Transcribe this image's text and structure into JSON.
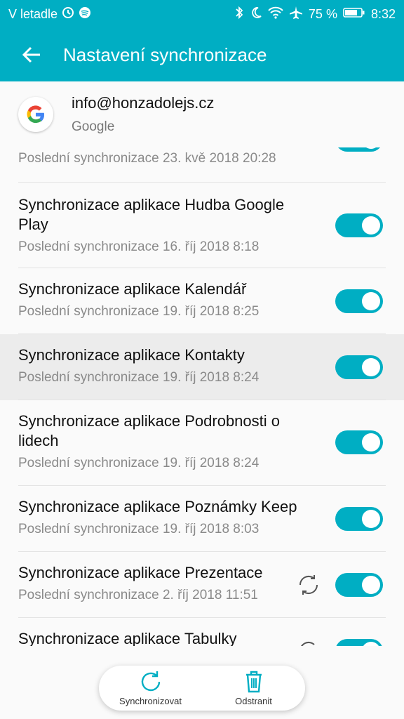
{
  "status": {
    "carrier": "V letadle",
    "battery": "75 %",
    "time": "8:32"
  },
  "header": {
    "title": "Nastavení synchronizace"
  },
  "account": {
    "email": "info@honzadolejs.cz",
    "type": "Google"
  },
  "items": [
    {
      "title": "",
      "subtitle": "Poslední synchronizace 23. kvě 2018 20:28",
      "enabled": true
    },
    {
      "title": "Synchronizace aplikace Hudba Google Play",
      "subtitle": "Poslední synchronizace 16. říj 2018 8:18",
      "enabled": true
    },
    {
      "title": "Synchronizace aplikace Kalendář",
      "subtitle": "Poslední synchronizace 19. říj 2018 8:25",
      "enabled": true
    },
    {
      "title": "Synchronizace aplikace Kontakty",
      "subtitle": "Poslední synchronizace 19. říj 2018 8:24",
      "enabled": true
    },
    {
      "title": "Synchronizace aplikace Podrobnosti o lidech",
      "subtitle": "Poslední synchronizace 19. říj 2018 8:24",
      "enabled": true
    },
    {
      "title": "Synchronizace aplikace Poznámky Keep",
      "subtitle": "Poslední synchronizace 19. říj 2018 8:03",
      "enabled": true
    },
    {
      "title": "Synchronizace aplikace Prezentace",
      "subtitle": "Poslední synchronizace 2. říj 2018 11:51",
      "enabled": true,
      "syncing": true
    },
    {
      "title": "Synchronizace aplikace Tabulky",
      "subtitle": "",
      "enabled": true,
      "syncing": true
    }
  ],
  "actions": {
    "sync_label": "Synchronizovat",
    "remove_label": "Odstranit"
  },
  "colors": {
    "accent": "#00aec3"
  }
}
